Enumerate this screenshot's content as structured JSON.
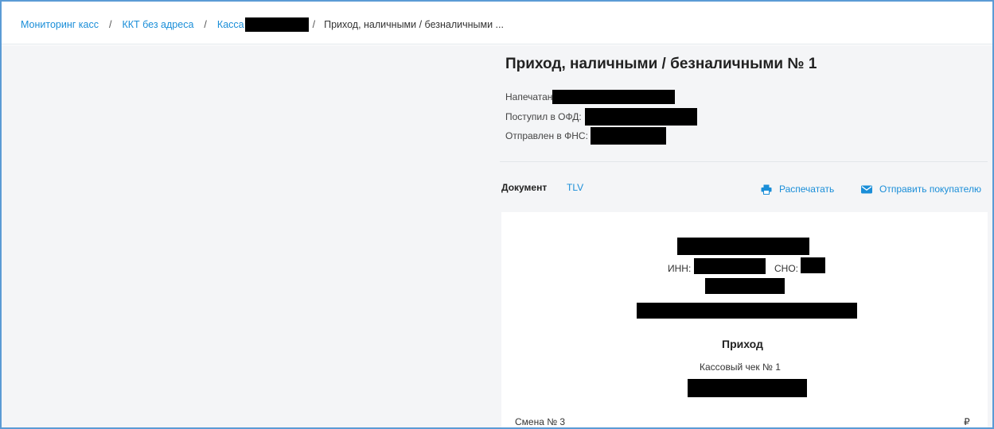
{
  "breadcrumb": {
    "items": [
      "Мониторинг касс",
      "ККТ без адреса",
      "Касса"
    ],
    "separator": "/",
    "current": "Приход, наличными / безналичными ..."
  },
  "document": {
    "title": "Приход, наличными / безналичными № 1",
    "printed_label": "Напечатан",
    "ofd_label": "Поступил в ОФД:",
    "fns_label": "Отправлен в ФНС:"
  },
  "tabs": {
    "document": "Документ",
    "tlv": "TLV"
  },
  "actions": {
    "print": "Распечатать",
    "send": "Отправить покупателю",
    "print_icon": "printer-icon",
    "send_icon": "envelope-icon"
  },
  "receipt": {
    "inn_label": "ИНН:",
    "sno_label": "СНО:",
    "type": "Приход",
    "check": "Кассовый чек  № 1",
    "shift": "Смена № 3",
    "currency": "₽"
  },
  "colors": {
    "link": "#1a8ed8",
    "border": "#5b9bd5",
    "pane": "#f4f5f7",
    "redaction": "#000000"
  }
}
